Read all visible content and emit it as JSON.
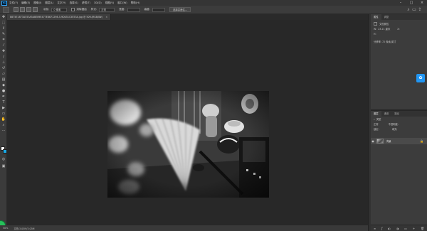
{
  "menubar": {
    "logo": "Ps",
    "items": [
      "文件(F)",
      "编辑(E)",
      "图像(I)",
      "图层(L)",
      "文字(Y)",
      "选择(S)",
      "滤镜(T)",
      "3D(D)",
      "视图(V)",
      "窗口(W)",
      "帮助(H)"
    ],
    "minimize": "–",
    "maximize": "□",
    "close": "×"
  },
  "options": {
    "feather_label": "羽化:",
    "feather_value": "0 像素",
    "antialias_label": "消除锯齿",
    "style_label": "样式:",
    "style_value": "正常",
    "width_label": "宽度:",
    "height_label": "高度:",
    "select_mask_button": "选择并遮住..."
  },
  "tab": {
    "title": "8875E1873A553A5A8E89E477E8671298-5-9D051C5E53A.jpg @ 50%(RGB/8#)",
    "close": "×"
  },
  "status": {
    "zoom": "50%",
    "doc_info": "文档:3.05M/3.05M"
  },
  "properties_panel": {
    "tabs": [
      "属性",
      "调整"
    ],
    "title": "文档属性",
    "w_label": "W:",
    "w_value": "23.21 厘米",
    "h_label": "H:",
    "x_label": "X:",
    "resolution": "分辨率: 72 像素/英寸"
  },
  "layers_panel": {
    "tabs": [
      "图层",
      "通道",
      "路径"
    ],
    "kind_label": "类型",
    "blend_mode": "正常",
    "opacity_label": "不透明度:",
    "lock_label": "锁定:",
    "fill_label": "填充:",
    "layer_name": "背景"
  },
  "colors": {
    "foreground": "#ffffff",
    "background": "#19a9e6",
    "accent": "#2196f3"
  }
}
